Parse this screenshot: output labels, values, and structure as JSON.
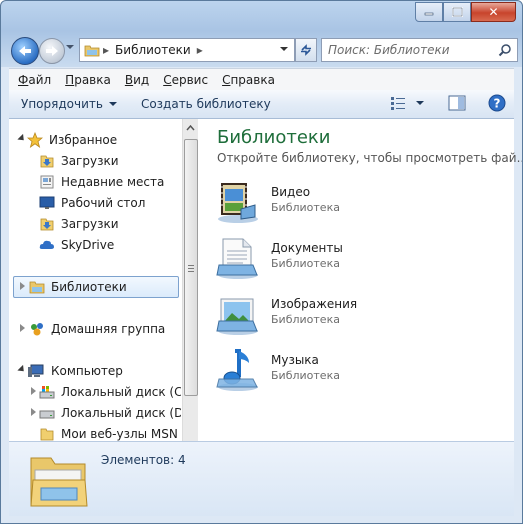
{
  "window": {
    "close_glyph": "✕"
  },
  "address": {
    "path": "Библиотеки",
    "separator": "▸"
  },
  "search": {
    "placeholder": "Поиск: Библиотеки"
  },
  "menu": [
    "Файл",
    "Правка",
    "Вид",
    "Сервис",
    "Справка"
  ],
  "menu_underline": [
    "Ф",
    "П",
    "В",
    "С",
    "С"
  ],
  "menu_rest": [
    "айл",
    "равка",
    "ид",
    "ервис",
    "правка"
  ],
  "toolbar": {
    "organize": "Упорядочить",
    "new_library": "Создать библиотеку"
  },
  "nav": {
    "favorites": "Избранное",
    "downloads": "Загрузки",
    "recent": "Недавние места",
    "desktop": "Рабочий стол",
    "downloads2": "Загрузки",
    "skydrive": "SkyDrive",
    "libraries": "Библиотеки",
    "homegroup": "Домашняя группа",
    "computer": "Компьютер",
    "disk_c": "Локальный диск (C:)",
    "disk_d": "Локальный диск (D:)",
    "msn": "Мои веб-узлы MSN"
  },
  "main": {
    "title": "Библиотеки",
    "subtitle": "Откройте библиотеку, чтобы просмотреть фай...",
    "items": [
      {
        "name": "Видео",
        "type": "Библиотека",
        "icon": "video-library-icon"
      },
      {
        "name": "Документы",
        "type": "Библиотека",
        "icon": "documents-library-icon"
      },
      {
        "name": "Изображения",
        "type": "Библиотека",
        "icon": "pictures-library-icon"
      },
      {
        "name": "Музыка",
        "type": "Библиотека",
        "icon": "music-library-icon"
      }
    ]
  },
  "details": {
    "count": "Элементов: 4"
  },
  "colors": {
    "title_green": "#1f6e3b",
    "accent_blue": "#1e395b",
    "selection_border": "#7da2ce"
  }
}
